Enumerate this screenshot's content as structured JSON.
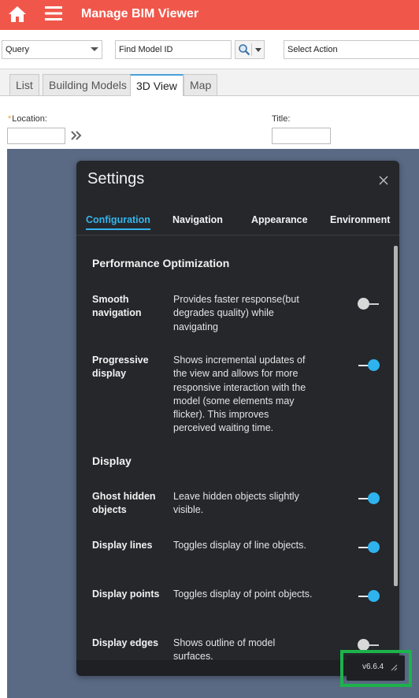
{
  "header": {
    "title": "Manage BIM Viewer",
    "bg_color": "#f0574a",
    "home_icon": "home-icon",
    "menu_icon": "hamburger-menu-icon"
  },
  "toolbar": {
    "query_value": "Query",
    "find_value": "Find Model ID",
    "action_value": "Select Action",
    "search_icon": "search-icon"
  },
  "tabs": [
    {
      "label": "List",
      "active": false
    },
    {
      "label": "Building Models",
      "active": false
    },
    {
      "label": "3D View",
      "active": true
    },
    {
      "label": "Map",
      "active": false
    }
  ],
  "form": {
    "location_label": "Location:",
    "location_required": "*",
    "title_label": "Title:",
    "location_value": "",
    "title_value": ""
  },
  "settings": {
    "title": "Settings",
    "close_icon": "close-icon",
    "accent_color": "#35b5ee",
    "tabs": [
      {
        "label": "Configuration",
        "active": true
      },
      {
        "label": "Navigation",
        "active": false
      },
      {
        "label": "Appearance",
        "active": false
      },
      {
        "label": "Environment",
        "active": false
      }
    ],
    "sections": [
      {
        "title": "Performance Optimization",
        "rows": [
          {
            "label": "Smooth navigation",
            "desc": "Provides faster response(but degrades quality) while navigating",
            "enabled": false
          },
          {
            "label": "Progressive display",
            "desc": "Shows incremental updates of the view and allows for more responsive interaction with the model (some elements may flicker). This improves perceived waiting time.",
            "enabled": true
          }
        ]
      },
      {
        "title": "Display",
        "rows": [
          {
            "label": "Ghost hidden objects",
            "desc": "Leave hidden objects slightly visible.",
            "enabled": true
          },
          {
            "label": "Display lines",
            "desc": "Toggles display of line objects.",
            "enabled": true
          },
          {
            "label": "Display points",
            "desc": "Toggles display of point objects.",
            "enabled": true
          },
          {
            "label": "Display edges",
            "desc": "Shows outline of model surfaces.",
            "enabled": false
          }
        ]
      }
    ],
    "version": "v6.6.4"
  }
}
